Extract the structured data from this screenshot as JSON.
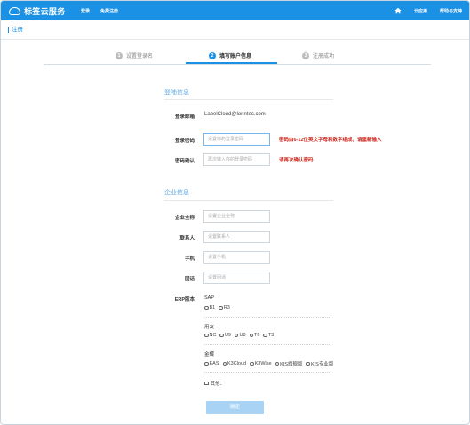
{
  "app": {
    "title": "标签云服务"
  },
  "nav": {
    "login": "登录",
    "register": "免费注册",
    "cloud_apps": "云应用",
    "help": "帮助与支持"
  },
  "page": {
    "title": "注册"
  },
  "steps": [
    {
      "num": "1",
      "label": "设置登录名",
      "state": "done"
    },
    {
      "num": "2",
      "label": "填写账户信息",
      "state": "active"
    },
    {
      "num": "3",
      "label": "注册成功",
      "state": "pending"
    }
  ],
  "login_section": {
    "title": "登陆信息",
    "email_label": "登录邮箱",
    "email_value": "LabelCloud@lonntec.com",
    "password_label": "登录密码",
    "password_placeholder": "设置你的登录密码",
    "password_hint": "密码由6-12位英文字母和数字组成，请重新输入",
    "confirm_label": "密码确认",
    "confirm_placeholder": "再次输入你的登录密码",
    "confirm_hint": "请再次确认密码"
  },
  "company_section": {
    "title": "企业信息",
    "name_label": "企业全称",
    "name_placeholder": "设置企业全称",
    "contact_label": "联系人",
    "contact_placeholder": "设置联系人",
    "phone_label": "手机",
    "phone_placeholder": "设置手机",
    "tel_label": "固话",
    "tel_placeholder": "设置固话",
    "erp_label": "ERP版本"
  },
  "erp": {
    "sap": {
      "title": "SAP",
      "options": [
        "B1",
        "R3"
      ]
    },
    "yonyou": {
      "title": "用友",
      "options": [
        "NC",
        "U9",
        "U8",
        "T6",
        "T3"
      ]
    },
    "kingdee": {
      "title": "金蝶",
      "options": [
        "EAS",
        "K3Cloud",
        "K3Wise",
        "KIS旗舰版",
        "KIS专业版"
      ]
    },
    "other_label": "其他："
  },
  "submit_label": "确定",
  "colors": {
    "brand": "#1a91e5",
    "error": "#d0271e",
    "button_disabled": "#a8d3f4"
  }
}
